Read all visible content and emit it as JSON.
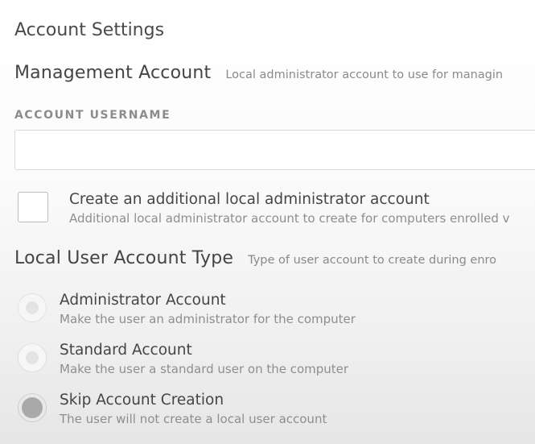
{
  "page": {
    "title": "Account Settings"
  },
  "management": {
    "title": "Management Account",
    "description": "Local administrator account to use for managin"
  },
  "username_field": {
    "label": "ACCOUNT USERNAME",
    "value": "",
    "placeholder": ""
  },
  "additional_admin": {
    "label": "Create an additional local administrator account",
    "description": "Additional local administrator account to create for computers enrolled v",
    "checked": false
  },
  "local_user": {
    "title": "Local User Account Type",
    "description": "Type of user account to create during enro",
    "selected": "skip",
    "options": [
      {
        "id": "administrator",
        "label": "Administrator Account",
        "description": "Make the user an administrator for the computer"
      },
      {
        "id": "standard",
        "label": "Standard Account",
        "description": "Make the user a standard user on the computer"
      },
      {
        "id": "skip",
        "label": "Skip Account Creation",
        "description": "The user will not create a local user account"
      }
    ]
  }
}
